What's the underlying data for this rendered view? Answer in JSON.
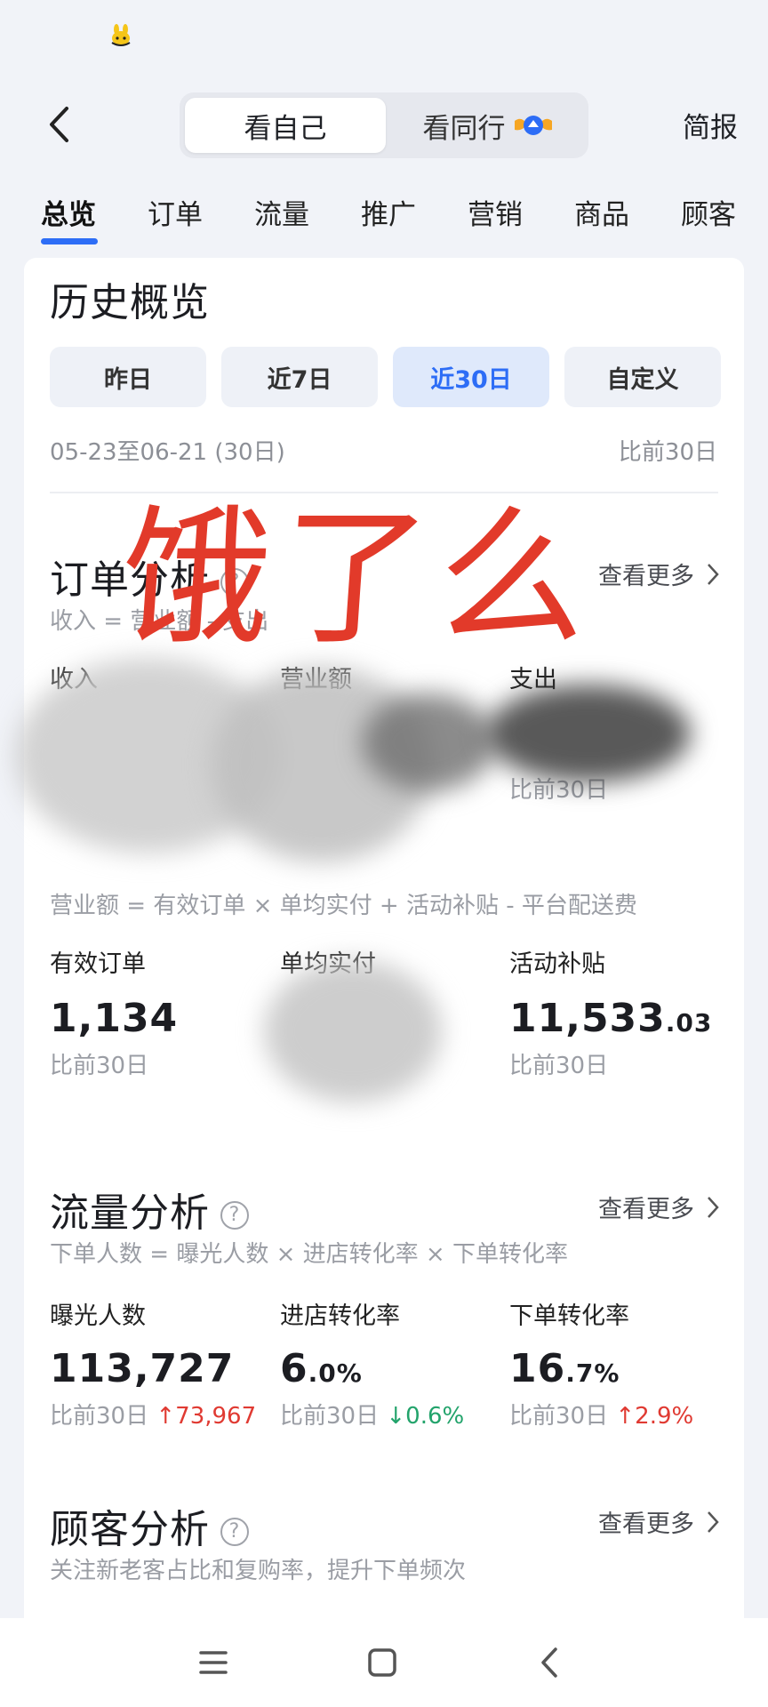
{
  "topbar": {
    "segment_self": "看自己",
    "segment_peer": "看同行",
    "brief": "简报"
  },
  "tabs": [
    "总览",
    "订单",
    "流量",
    "推广",
    "营销",
    "商品",
    "顾客"
  ],
  "history": {
    "title": "历史概览",
    "periods": [
      "昨日",
      "近7日",
      "近30日",
      "自定义"
    ],
    "selected_period": "近30日",
    "range": "05-23至06-21 (30日)",
    "compare": "比前30日"
  },
  "watermark": "饿了么",
  "orders": {
    "title": "订单分析",
    "more": "查看更多",
    "formula1": "收入 = 营业额 - 支出",
    "income_label": "收入",
    "revenue_label": "营业额",
    "expense_label": "支出",
    "expense_compare": "比前30日",
    "formula2": "营业额 = 有效订单 × 单均实付 + 活动补贴 - 平台配送费",
    "valid_orders_label": "有效订单",
    "valid_orders_value": "1,134",
    "valid_orders_compare": "比前30日",
    "avg_paid_label": "单均实付",
    "subsidy_label": "活动补贴",
    "subsidy_value_int": "11,533",
    "subsidy_value_dec": ".03",
    "subsidy_compare": "比前30日"
  },
  "traffic": {
    "title": "流量分析",
    "more": "查看更多",
    "formula": "下单人数 = 曝光人数 × 进店转化率 × 下单转化率",
    "exposure_label": "曝光人数",
    "exposure_value": "113,727",
    "exposure_compare": "比前30日",
    "exposure_delta": "73,967",
    "store_conv_label": "进店转化率",
    "store_conv_int": "6",
    "store_conv_dec": ".0%",
    "store_conv_compare": "比前30日",
    "store_conv_delta": "0.6%",
    "order_conv_label": "下单转化率",
    "order_conv_int": "16",
    "order_conv_dec": ".7%",
    "order_conv_compare": "比前30日",
    "order_conv_delta": "2.9%"
  },
  "customers": {
    "title": "顾客分析",
    "more": "查看更多",
    "subtitle": "关注新老客占比和复购率，提升下单频次"
  },
  "colors": {
    "accent": "#2d6df6",
    "up": "#e03a32",
    "down": "#22a36b",
    "watermark": "#e23a2a"
  },
  "icons": [
    "back-icon",
    "chevron-right-icon",
    "help-icon",
    "arrow-up-icon",
    "arrow-down-icon",
    "menu-icon",
    "home-icon"
  ]
}
